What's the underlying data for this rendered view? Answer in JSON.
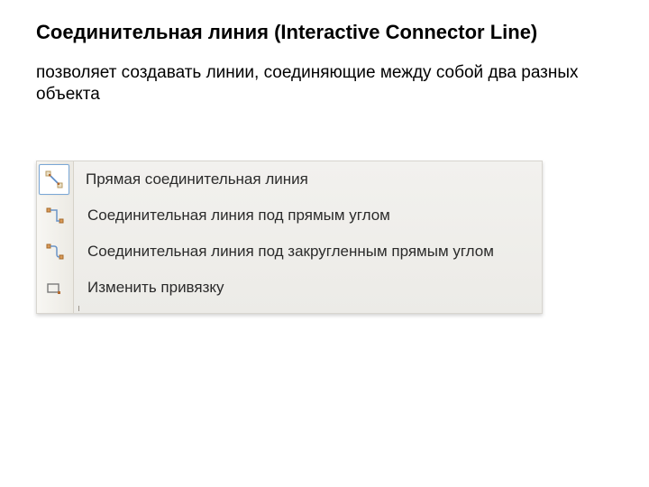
{
  "title": "Соединительная линия  (Interactive Connector Line)",
  "description": "позволяет создавать линии, соединяющие между собой два разных объекта",
  "menu": {
    "items": [
      {
        "icon": "straight-connector-icon",
        "label": "Прямая соединительная линия",
        "selected": true
      },
      {
        "icon": "right-angle-connector-icon",
        "label": "Соединительная линия под прямым углом",
        "selected": false
      },
      {
        "icon": "rounded-right-angle-connector-icon",
        "label": "Соединительная линия под закругленным прямым углом",
        "selected": false
      },
      {
        "icon": "change-anchor-icon",
        "label": "Изменить привязку",
        "selected": false
      }
    ]
  }
}
